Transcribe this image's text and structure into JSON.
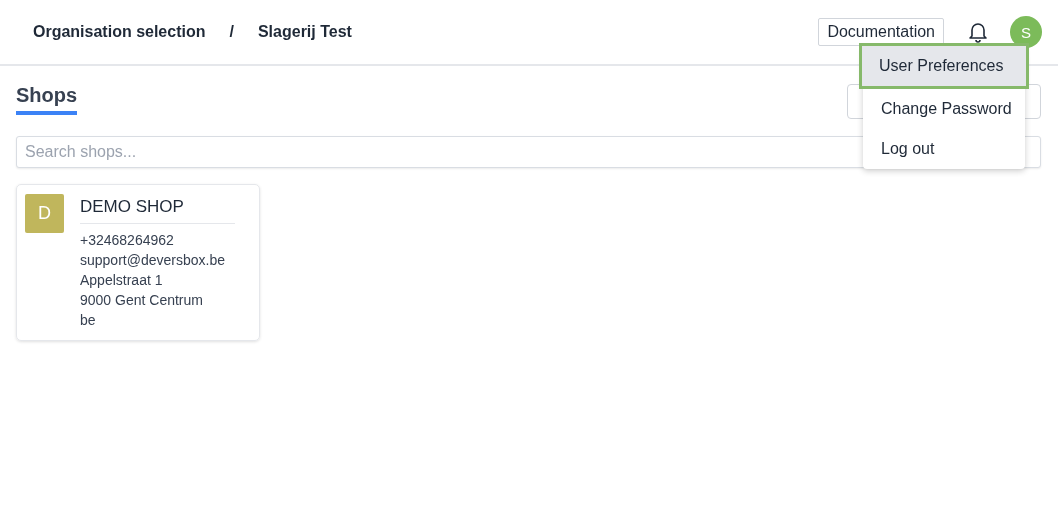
{
  "breadcrumb": [
    "Organisation selection",
    "/",
    "Slagerij Test"
  ],
  "header": {
    "documentation": "Documentation",
    "avatar": "S"
  },
  "user_menu": [
    {
      "label": "User Preferences",
      "selected": true
    },
    {
      "label": "Change Password",
      "selected": false
    },
    {
      "label": "Log out",
      "selected": false
    }
  ],
  "page_title": "Shops",
  "search": {
    "placeholder": "Search shops..."
  },
  "shops": [
    {
      "initial": "D",
      "color": "#c0b65c",
      "name": "DEMO SHOP",
      "lines": [
        "+32468264962",
        "support@deversbox.be",
        "Appelstraat 1",
        "9000 Gent Centrum",
        "be"
      ]
    }
  ]
}
